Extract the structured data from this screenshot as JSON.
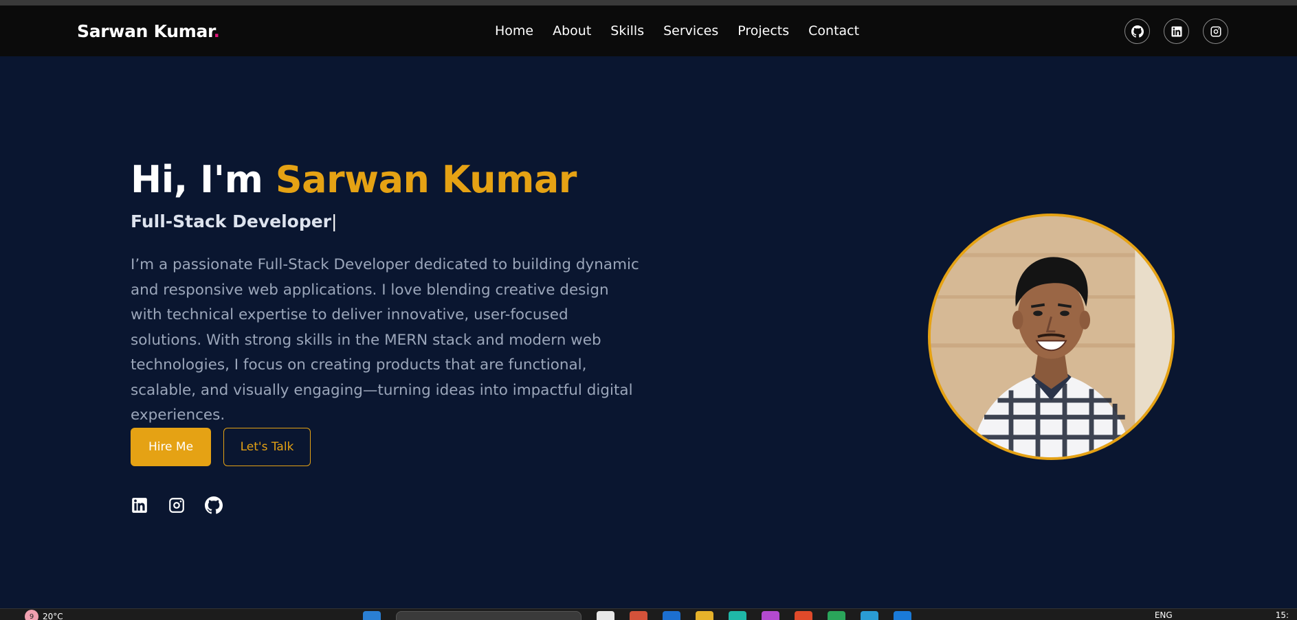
{
  "brand": {
    "name": "Sarwan Kumar",
    "dot": "."
  },
  "nav": {
    "links": [
      {
        "label": "Home"
      },
      {
        "label": "About"
      },
      {
        "label": "Skills"
      },
      {
        "label": "Services"
      },
      {
        "label": "Projects"
      },
      {
        "label": "Contact"
      }
    ],
    "social_icons": [
      "github-icon",
      "linkedin-icon",
      "instagram-icon"
    ]
  },
  "hero": {
    "greeting": "Hi, I'm ",
    "name": "Sarwan Kumar",
    "role": "Full-Stack Developer",
    "cursor": "|",
    "description": "I’m a passionate Full-Stack Developer dedicated to building dynamic and responsive web applications. I love blending creative design with technical expertise to deliver innovative, user-focused solutions. With strong skills in the MERN stack and modern web technologies, I focus on creating products that are functional, scalable, and visually engaging—turning ideas into impactful digital experiences.",
    "primary_button": "Hire Me",
    "secondary_button": "Let's Talk",
    "social_icons": [
      "linkedin-icon",
      "instagram-icon",
      "github-icon"
    ]
  },
  "taskbar": {
    "weather_badge": "9",
    "temperature": "20°C",
    "language": "ENG",
    "time": "15:"
  },
  "colors": {
    "background": "#0a1630",
    "navbar": "#0b0b0b",
    "accent": "#e5a214",
    "brand_dot": "#e0147a",
    "description_text": "#9ba6ba"
  }
}
